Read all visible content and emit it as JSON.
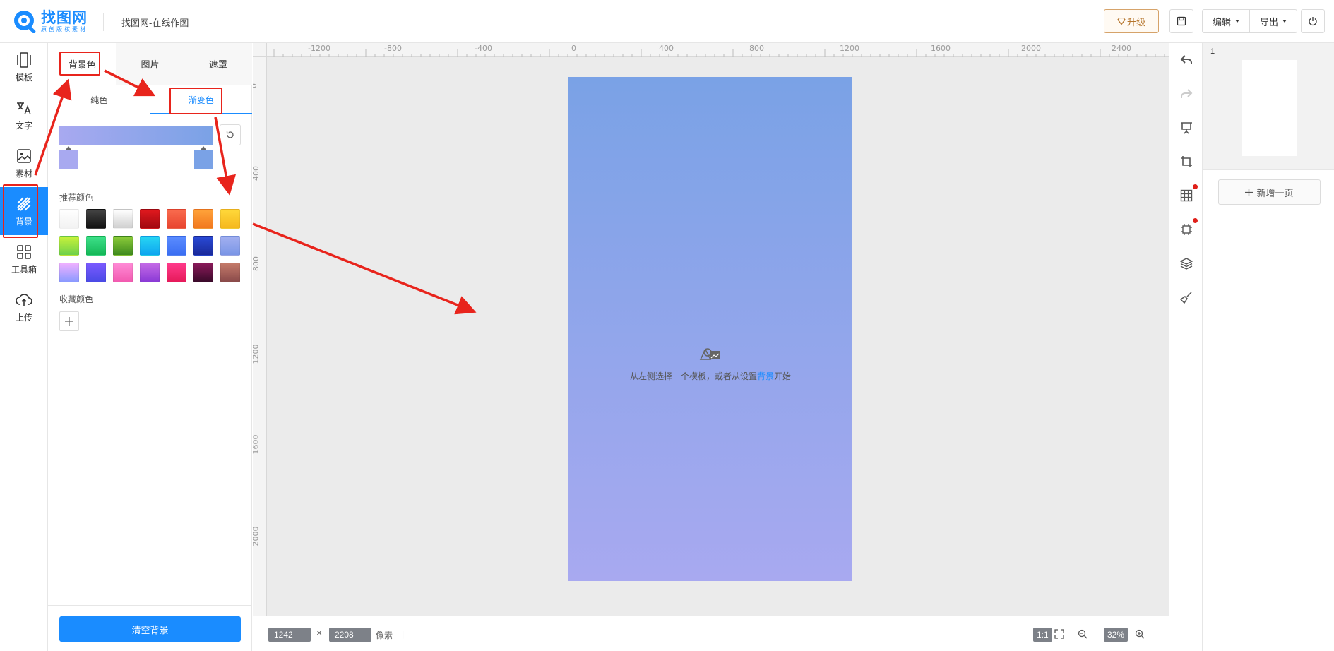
{
  "header": {
    "logo_title": "找图网",
    "logo_sub": "原创版权素材",
    "doc_title": "找图网-在线作图",
    "upgrade_label": "升级",
    "edit_label": "编辑",
    "export_label": "导出"
  },
  "leftnav": {
    "items": [
      {
        "label": "模板",
        "icon": "template-icon"
      },
      {
        "label": "文字",
        "icon": "text-translate-icon"
      },
      {
        "label": "素材",
        "icon": "image-icon"
      },
      {
        "label": "背景",
        "icon": "background-stripes-icon"
      },
      {
        "label": "工具箱",
        "icon": "grid-icon"
      },
      {
        "label": "上传",
        "icon": "cloud-upload-icon"
      }
    ],
    "active": "背景"
  },
  "panel": {
    "tabs": [
      "背景色",
      "图片",
      "遮罩"
    ],
    "active_tab": "背景色",
    "subtabs": [
      "纯色",
      "渐变色"
    ],
    "active_subtab": "渐变色",
    "gradient": {
      "start": "#a8a9f0",
      "end": "#7aa2e6"
    },
    "recommended_label": "推荐颜色",
    "favorites_label": "收藏颜色",
    "clear_label": "清空背景",
    "swatches": [
      "linear-gradient(#ffffff,#f2f2f2)",
      "linear-gradient(#444,#111)",
      "linear-gradient(#ffffff,#cfcfcf)",
      "linear-gradient(#e0191e,#a10810)",
      "linear-gradient(#f96b4e,#e8452f)",
      "linear-gradient(#ffa33a,#f2781e)",
      "linear-gradient(#ffd83a,#f5b81e)",
      "linear-gradient(#c9f23a,#6fd14a)",
      "linear-gradient(#3ee08a,#14b857)",
      "linear-gradient(#8ccc3a,#3f8a1e)",
      "linear-gradient(#27d6f2,#0ea5f0)",
      "linear-gradient(#5b8cff,#3a6ef2)",
      "linear-gradient(#2a4ad6,#1a2a9a)",
      "linear-gradient(#a3b0f0,#7a95e6)",
      "linear-gradient(#f0b0ff,#8a9aff)",
      "linear-gradient(#7a5aff,#4a4ae6)",
      "linear-gradient(#ff8ad6,#f25ab0)",
      "linear-gradient(#c46ae6,#8a3ad6)",
      "linear-gradient(#ff3a8a,#e61a5a)",
      "linear-gradient(#8a1a5a,#3a0a2a)",
      "linear-gradient(#c47a6a,#8a4a4a)"
    ]
  },
  "canvas": {
    "ruler_top": [
      "-1200",
      "-800",
      "-400",
      "0",
      "400",
      "800",
      "1200",
      "1600",
      "2000",
      "2400"
    ],
    "ruler_left": [
      "0",
      "400",
      "800",
      "1200",
      "1600",
      "2000"
    ],
    "hint_prefix": "从左侧选择一个模板，或者从设置",
    "hint_link": "背景",
    "hint_suffix": "开始",
    "artboard_gradient": {
      "top": "#7aa2e6",
      "bottom": "#a8a9f0"
    }
  },
  "bottombar": {
    "width": "1242",
    "height": "2208",
    "times": "×",
    "unit": "像素",
    "sep": "|",
    "ratio_label": "1:1",
    "zoom": "32%"
  },
  "righttools": [
    "undo-icon",
    "redo-icon",
    "presentation-icon",
    "crop-icon",
    "table-icon",
    "chip-icon",
    "layers-icon",
    "brush-icon"
  ],
  "pages": {
    "page_number": "1",
    "add_page_label": "新增一页"
  },
  "colors": {
    "accent": "#1a8cff",
    "annotation": "#e8241c",
    "upgrade": "#b5752c"
  }
}
